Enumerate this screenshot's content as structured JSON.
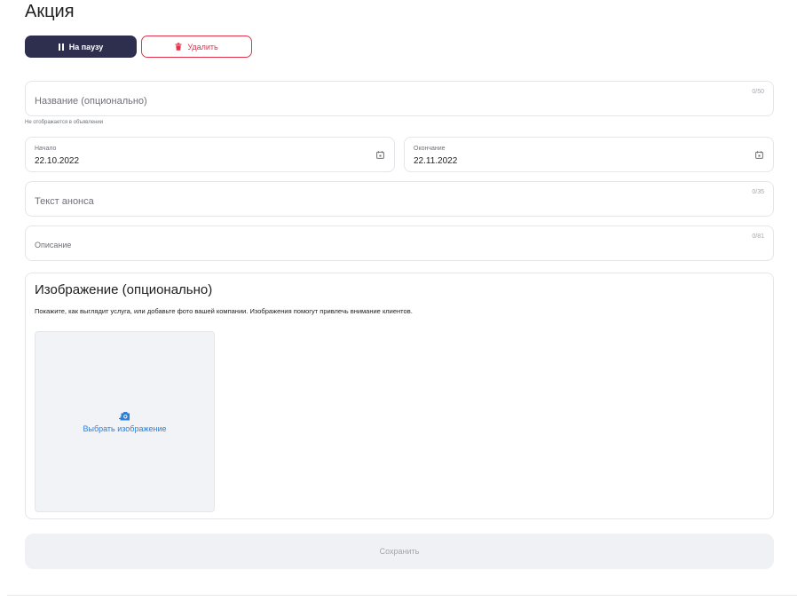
{
  "page": {
    "title": "Акция"
  },
  "actions": {
    "pause_label": "На паузу",
    "delete_label": "Удалить"
  },
  "name_field": {
    "placeholder": "Название (опционально)",
    "counter": "0/50",
    "hint": "Не отображается в объявлении"
  },
  "start_field": {
    "label": "Начало",
    "value": "22.10.2022"
  },
  "end_field": {
    "label": "Окончание",
    "value": "22.11.2022"
  },
  "announce_field": {
    "placeholder": "Текст анонса",
    "counter": "0/35"
  },
  "description_field": {
    "placeholder": "Описание",
    "counter": "0/81"
  },
  "image_section": {
    "title": "Изображение (опционально)",
    "description": "Покажите, как выглядит услуга, или добавьте фото вашей компании. Изображения помогут привлечь внимание клиентов.",
    "upload_label": "Выбрать изображение"
  },
  "save_label": "Сохранить",
  "colors": {
    "primary_dark": "#2e2f4f",
    "danger": "#e3324a",
    "link": "#2a7fd9",
    "border": "#e4e6ea"
  },
  "icons": {
    "pause": "pause-icon",
    "delete": "trash-icon",
    "calendar": "calendar-icon",
    "camera": "camera-add-icon"
  }
}
